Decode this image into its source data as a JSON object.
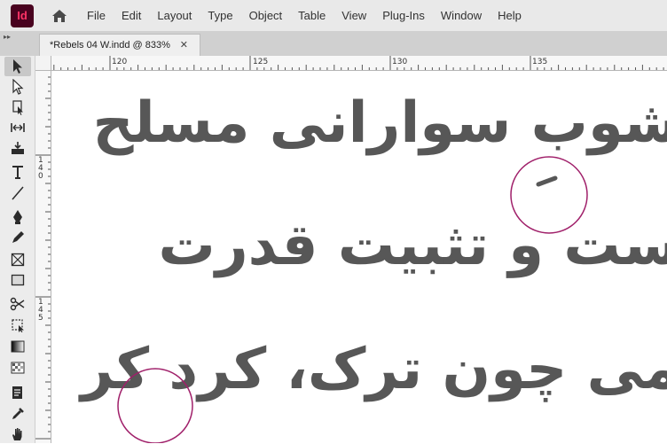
{
  "app": {
    "logo_text": "Id",
    "accent": "#ff3366",
    "logo_bg": "#49021f"
  },
  "menu": [
    "File",
    "Edit",
    "Layout",
    "Type",
    "Object",
    "Table",
    "View",
    "Plug-Ins",
    "Window",
    "Help"
  ],
  "document_tab": {
    "title": "*Rebels 04 W.indd @ 833%",
    "close_label": "✕"
  },
  "ruler": {
    "horizontal_labels": [
      "120",
      "125",
      "130",
      "135"
    ],
    "vertical_labels": [
      [
        "1",
        "4",
        "0"
      ],
      [
        "1",
        "4",
        "5"
      ]
    ]
  },
  "canvas": {
    "lines": [
      "شوب سوارانی مسلح ",
      "ست و تثبیت قدرت",
      "می چون ترک، کرد کر"
    ],
    "text_color": "#575757",
    "mark_color": "#a0206a"
  },
  "toolbar": {
    "tools": [
      "selection-tool",
      "direct-selection-tool",
      "page-tool",
      "gap-tool",
      "content-collector-tool",
      "type-tool",
      "line-tool",
      "pen-tool",
      "pencil-tool",
      "rectangle-frame-tool",
      "rectangle-tool",
      "scissors-tool",
      "free-transform-tool",
      "gradient-swatch-tool",
      "gradient-feather-tool",
      "note-tool",
      "eyedropper-tool",
      "hand-tool"
    ]
  }
}
